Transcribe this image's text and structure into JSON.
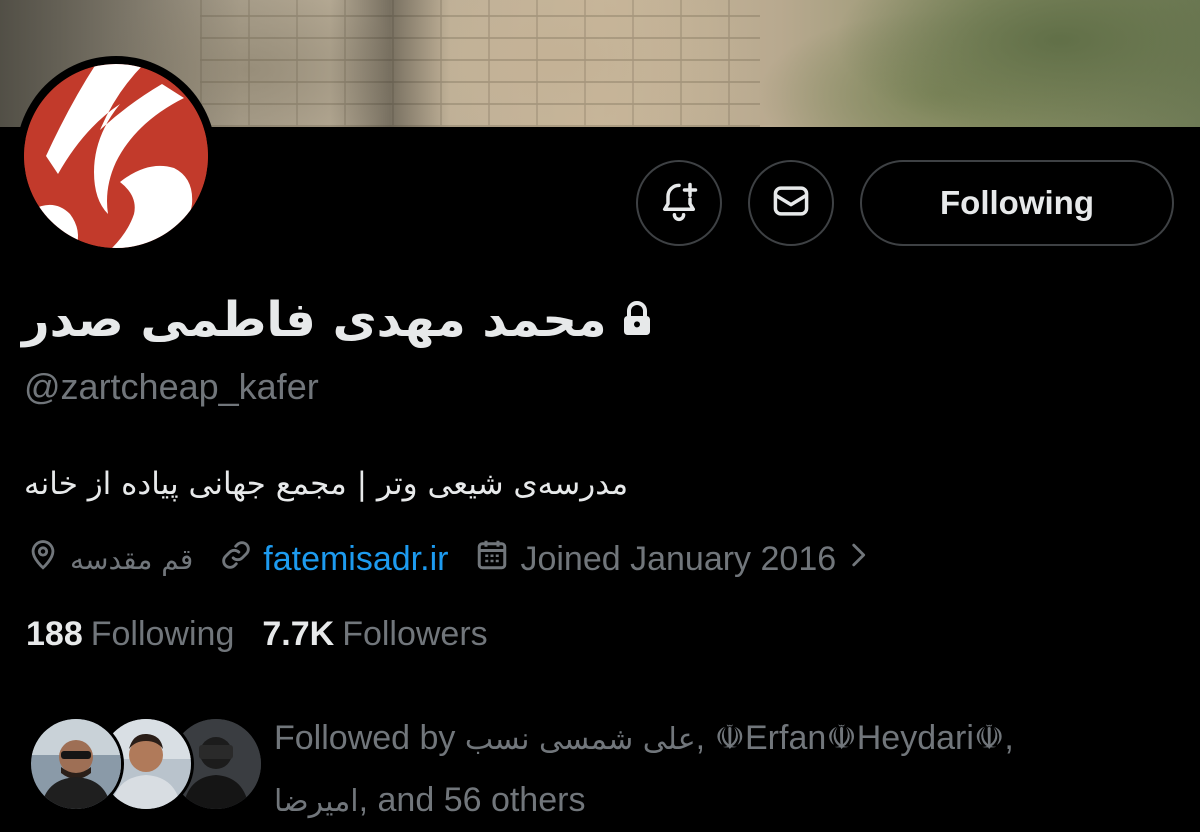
{
  "profile": {
    "display_name": "محمد مهدی فاطمی صدر",
    "handle": "@zartcheap_kafer",
    "bio": "مدرسه‌ی شیعی وتر | مجمع جهانی پیاده از خانه",
    "location": "قم مقدسه",
    "website": "fatemisadr.ir",
    "joined": "Joined January 2016",
    "protected_icon": "lock-icon"
  },
  "actions": {
    "notify_icon": "bell-plus-icon",
    "message_icon": "envelope-icon",
    "follow_label": "Following"
  },
  "stats": {
    "following_count": "188",
    "following_label": "Following",
    "followers_count": "7.7K",
    "followers_label": "Followers"
  },
  "followed_by": {
    "prefix": "Followed by",
    "name1": "علی شمسی نسب",
    "name2": "☫Erfan☫Heydari☫",
    "name3": "امیرضا",
    "suffix": ", and 56 others"
  },
  "colors": {
    "background": "#000000",
    "text_primary": "#e7e9ea",
    "text_secondary": "#71767b",
    "link": "#1d9bf0",
    "border": "#3e4144",
    "avatar_red": "#c23a2b"
  }
}
